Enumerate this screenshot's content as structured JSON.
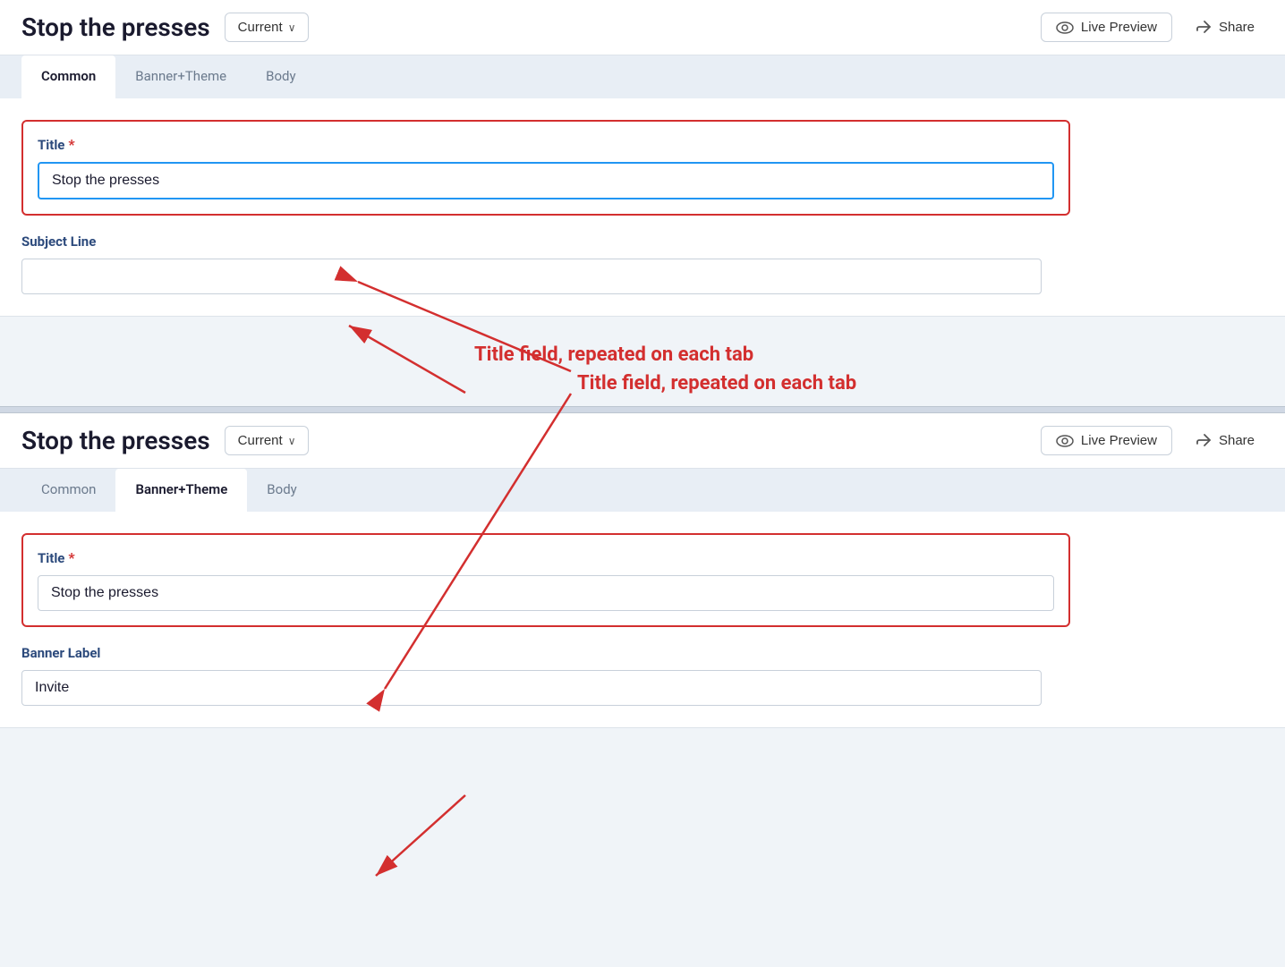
{
  "app": {
    "title": "Stop the presses"
  },
  "panel1": {
    "title": "Stop the presses",
    "current_btn": "Current",
    "live_preview_btn": "Live Preview",
    "share_btn": "Share",
    "tabs": [
      {
        "id": "common",
        "label": "Common",
        "active": true
      },
      {
        "id": "banner-theme",
        "label": "Banner+Theme",
        "active": false
      },
      {
        "id": "body",
        "label": "Body",
        "active": false
      }
    ],
    "title_field": {
      "label": "Title",
      "value": "Stop the presses",
      "required": true
    },
    "subject_line_field": {
      "label": "Subject Line",
      "value": "",
      "placeholder": ""
    }
  },
  "annotation": {
    "text": "Title field, repeated on each tab"
  },
  "panel2": {
    "title": "Stop the presses",
    "current_btn": "Current",
    "live_preview_btn": "Live Preview",
    "share_btn": "Share",
    "tabs": [
      {
        "id": "common",
        "label": "Common",
        "active": false
      },
      {
        "id": "banner-theme",
        "label": "Banner+Theme",
        "active": true
      },
      {
        "id": "body",
        "label": "Body",
        "active": false
      }
    ],
    "title_field": {
      "label": "Title",
      "value": "Stop the presses",
      "required": true
    },
    "banner_label_field": {
      "label": "Banner Label",
      "value": "Invite"
    }
  },
  "icons": {
    "chevron_down": "∨",
    "eye": "👁",
    "share": "↪"
  }
}
